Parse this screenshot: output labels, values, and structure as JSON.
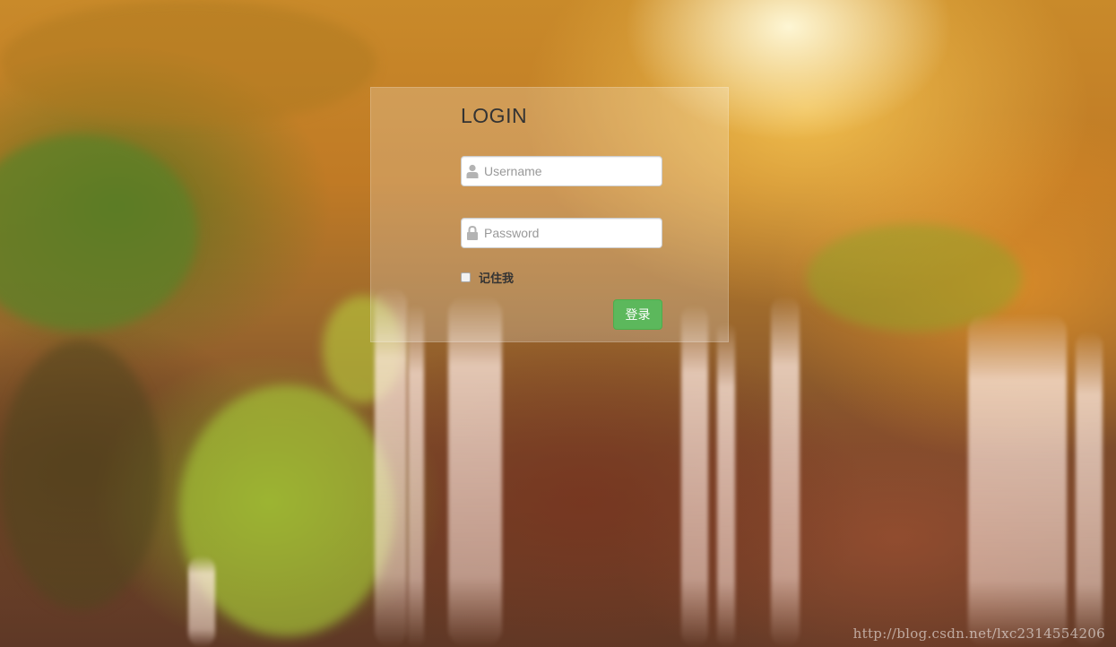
{
  "login": {
    "title": "LOGIN",
    "username_placeholder": "Username",
    "password_placeholder": "Password",
    "remember_label": "记住我",
    "submit_label": "登录"
  },
  "icons": {
    "username": "user-icon",
    "password": "lock-icon"
  },
  "colors": {
    "button_bg": "#5cb85c",
    "title_text": "#333333"
  },
  "watermark": "http://blog.csdn.net/lxc2314554206"
}
